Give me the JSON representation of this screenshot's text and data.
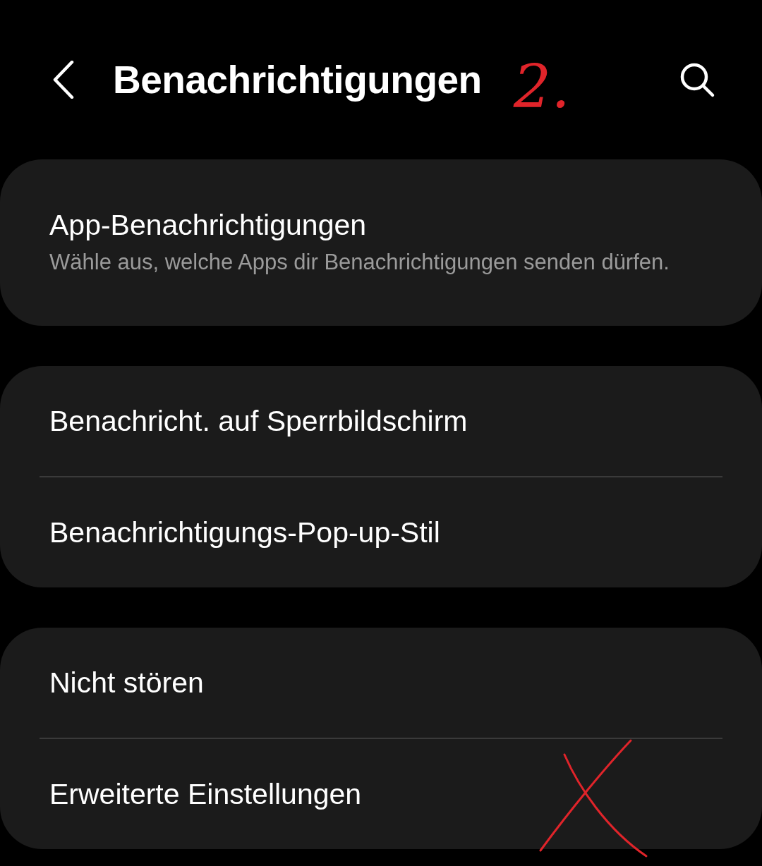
{
  "header": {
    "title": "Benachrichtigungen",
    "annotation": "2."
  },
  "groups": [
    {
      "items": [
        {
          "title": "App-Benachrichtigungen",
          "subtitle": "Wähle aus, welche Apps dir Benachrichtigungen senden dürfen.",
          "crossed_out": false
        }
      ]
    },
    {
      "items": [
        {
          "title": "Benachricht. auf Sperrbildschirm",
          "crossed_out": false
        },
        {
          "title": "Benachrichtigungs-Pop-up-Stil",
          "crossed_out": false
        }
      ]
    },
    {
      "items": [
        {
          "title": "Nicht stören",
          "crossed_out": false
        },
        {
          "title": "Erweiterte Einstellungen",
          "crossed_out": true
        }
      ]
    }
  ]
}
